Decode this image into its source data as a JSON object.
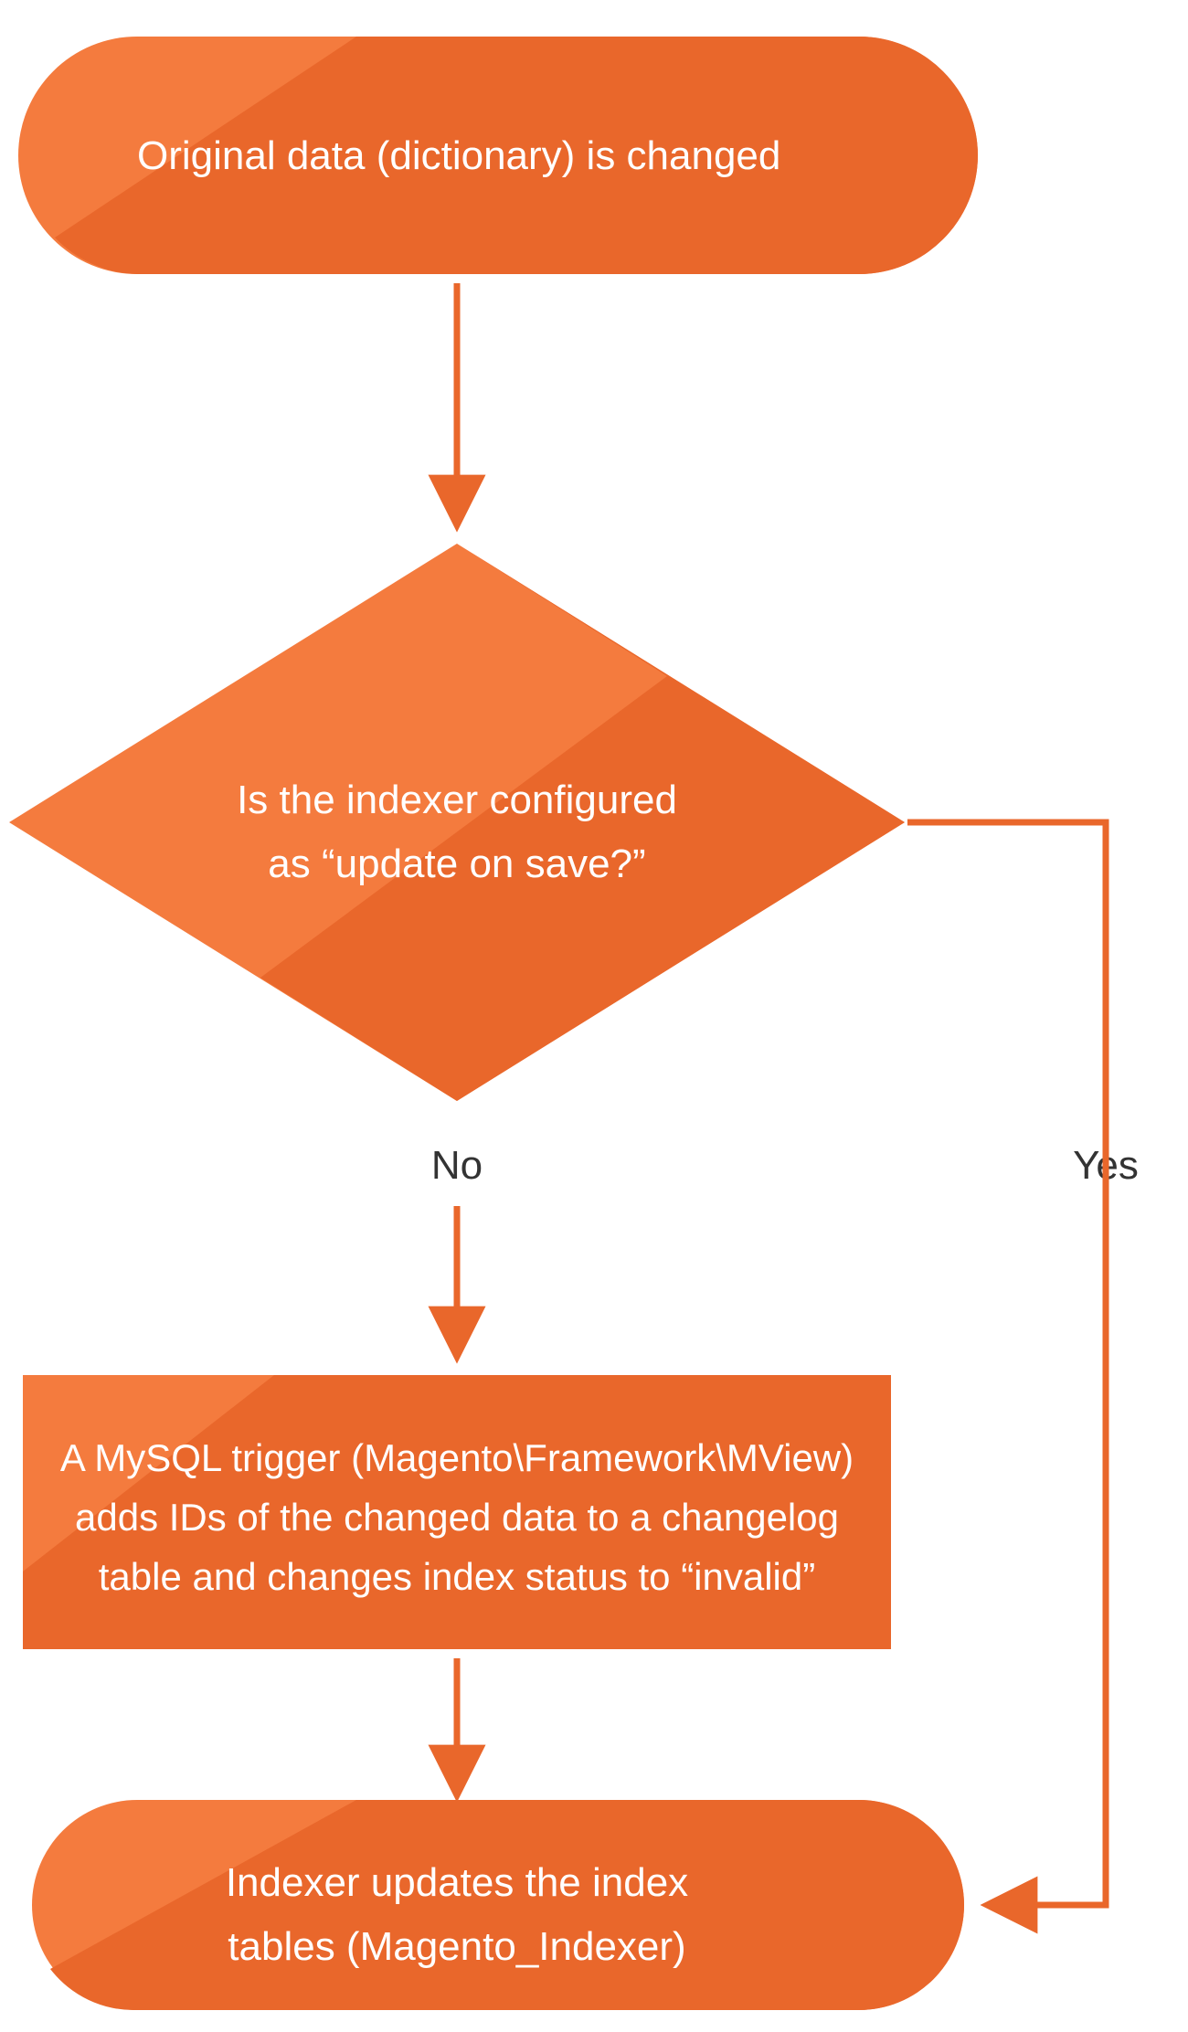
{
  "colors": {
    "light": "#f47b3e",
    "dark": "#e9672b",
    "stroke": "#e9672b",
    "label": "#333333",
    "text": "#ffffff"
  },
  "nodes": {
    "start": {
      "text": "Original data (dictionary) is changed"
    },
    "decision": {
      "line1": "Is the indexer configured",
      "line2": "as “update on save?”"
    },
    "trigger": {
      "line1": "A MySQL trigger (Magento\\Framework\\MView)",
      "line2": "adds IDs of the changed data to a changelog",
      "line3": "table and changes index status to “invalid”"
    },
    "indexer": {
      "line1": "Indexer updates the index",
      "line2": "tables   (Magento_Indexer)"
    }
  },
  "labels": {
    "no": "No",
    "yes": "Yes"
  }
}
